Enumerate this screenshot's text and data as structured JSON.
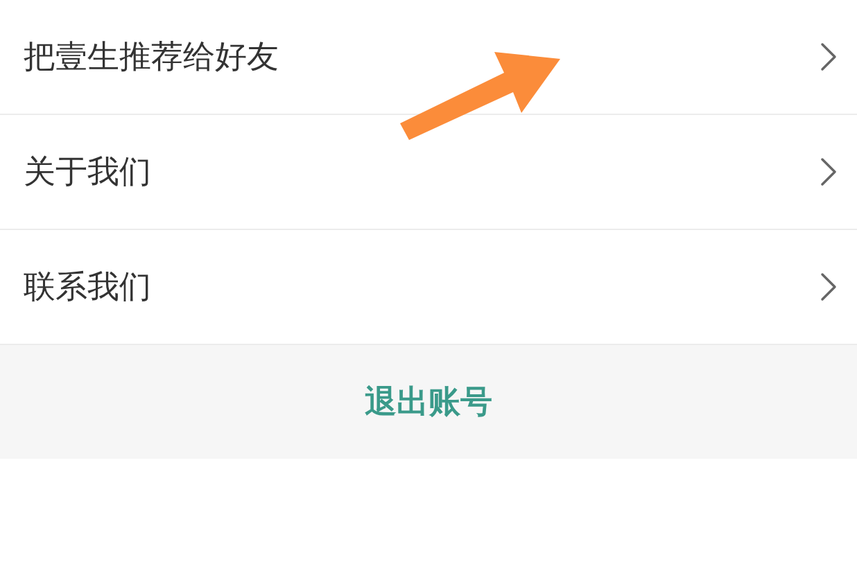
{
  "menu_items": [
    {
      "label": "把壹生推荐给好友"
    },
    {
      "label": "关于我们"
    },
    {
      "label": "联系我们"
    }
  ],
  "logout_button": {
    "label": "退出账号"
  }
}
